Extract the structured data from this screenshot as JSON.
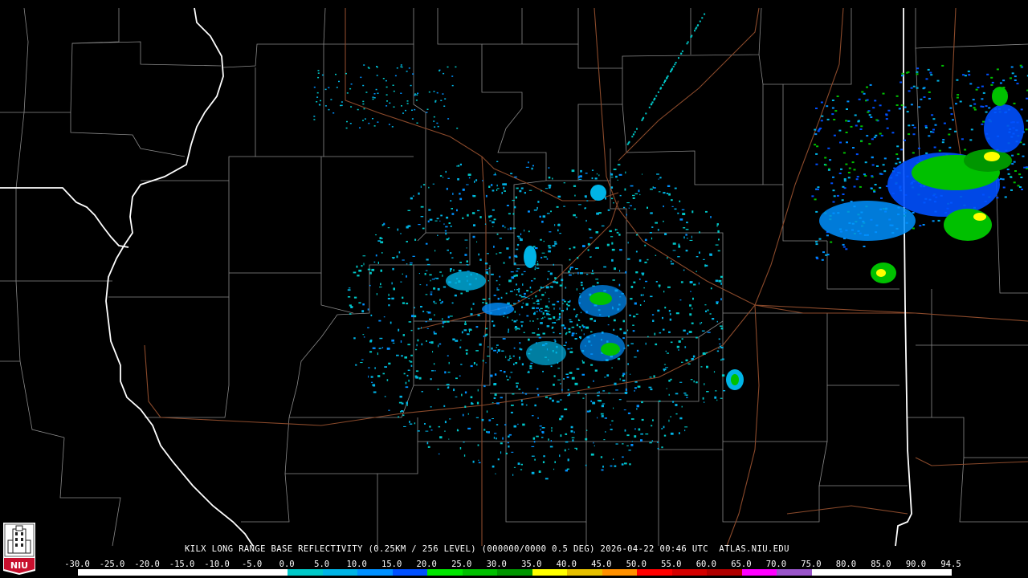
{
  "product_caption": "KILX LONG RANGE BASE REFLECTIVITY (0.25KM / 256 LEVEL) (000000/0000 0.5 DEG) 2026-04-22 00:46 UTC  ATLAS.NIU.EDU",
  "logo_text": "NIU",
  "colors": {
    "background": "#000000",
    "county_lines": "#8a8a8a",
    "state_lines": "#ffffff",
    "highways": "#8b4a2b"
  },
  "scale_labels": [
    "-30.0",
    "-25.0",
    "-20.0",
    "-15.0",
    "-10.0",
    "-5.0",
    "0.0",
    "5.0",
    "10.0",
    "15.0",
    "20.0",
    "25.0",
    "30.0",
    "35.0",
    "40.0",
    "45.0",
    "50.0",
    "55.0",
    "60.0",
    "65.0",
    "70.0",
    "75.0",
    "80.0",
    "85.0",
    "90.0",
    "94.5"
  ],
  "scale_colors": [
    "#ffffff",
    "#ffffff",
    "#ffffff",
    "#ffffff",
    "#ffffff",
    "#ffffff",
    "#00c8c8",
    "#00b4e6",
    "#0090ff",
    "#0050ff",
    "#00e600",
    "#00c000",
    "#009600",
    "#ffff00",
    "#e6c000",
    "#ff9000",
    "#ff0000",
    "#d40000",
    "#b00000",
    "#ff00ff",
    "#9955c9",
    "#ffffff",
    "#ffffff",
    "#ffffff",
    "#ffffff",
    "#ffffff"
  ]
}
